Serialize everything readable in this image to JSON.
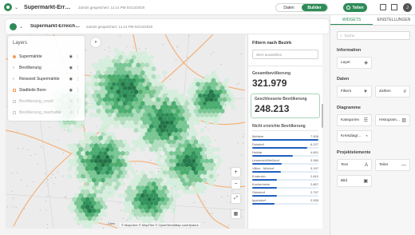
{
  "topbar": {
    "title": "Supermarkt-Erreichbarkeit",
    "saved": "Zuletzt gespeichert: 11:14 PM 04/12/2020",
    "mode_data": "Daten",
    "mode_builder": "Builder",
    "share": "Teilen",
    "avatar": "J"
  },
  "subbar": {
    "title": "Supermarkt-Erreichbarkeit",
    "saved": "Zuletzt gespeichert: 11:14 PM 04/12/2020"
  },
  "layers": {
    "title": "Layers",
    "items": [
      {
        "name": "Supermärkte",
        "type": "dot"
      },
      {
        "name": "Bevölkerung",
        "type": "chev"
      },
      {
        "name": "Reisezeit Supermärkte",
        "type": "chev"
      },
      {
        "name": "Stadtteile Bonn",
        "type": "sq"
      },
      {
        "name": "Bevölkerung_count",
        "type": "dim"
      },
      {
        "name": "Bevölkerung_reachable",
        "type": "dim"
      }
    ]
  },
  "widgets": {
    "filter_title": "Filtern nach Bezirk",
    "filter_placeholder": "Wert auswählen",
    "total_label": "Gesamtbevölkerung",
    "total_value": "321.979",
    "closed_label": "Geschlossene Bevölkerung",
    "closed_value": "248.213",
    "unreached_label": "Nicht erreichte Bevölkerung",
    "bars": [
      {
        "name": "Mehlem",
        "value": "7.508",
        "pct": 100
      },
      {
        "name": "Duisdorf",
        "value": "6.227",
        "pct": 83
      },
      {
        "name": "Holzlar",
        "value": "4.601",
        "pct": 61
      },
      {
        "name": "Lessenich/Meßdorf",
        "value": "3.360",
        "pct": 45
      },
      {
        "name": "Villich - Müldorf",
        "value": "3.197",
        "pct": 43
      },
      {
        "name": "Endenich",
        "value": "2.810",
        "pct": 37
      },
      {
        "name": "Kuchenheim",
        "value": "2.807",
        "pct": 37
      },
      {
        "name": "Gielsdorf",
        "value": "2.797",
        "pct": 37
      },
      {
        "name": "Ippendorf",
        "value": "2.535",
        "pct": 34
      }
    ]
  },
  "map": {
    "attribution": "© MapLibre  © MapTiler  © OpenStreetMap contributors",
    "scale": "1 km"
  },
  "rpanel": {
    "tab_widgets": "WIDGETS",
    "tab_settings": "EINSTELLUNGEN",
    "search_placeholder": "Suche",
    "sec_info": "Information",
    "sec_data": "Daten",
    "sec_charts": "Diagramme",
    "sec_project": "Projektelemente",
    "layer": "Layer",
    "filter": "Filtern",
    "numbers": "Zahlen",
    "categories": "Kategorien",
    "histogram": "Histogram...",
    "pie": "Kreisdiagr...",
    "text": "Text",
    "divider": "Teiler",
    "image": "Bild"
  },
  "colors": {
    "accent": "#2e8b57",
    "bar": "#1f5fbf"
  }
}
